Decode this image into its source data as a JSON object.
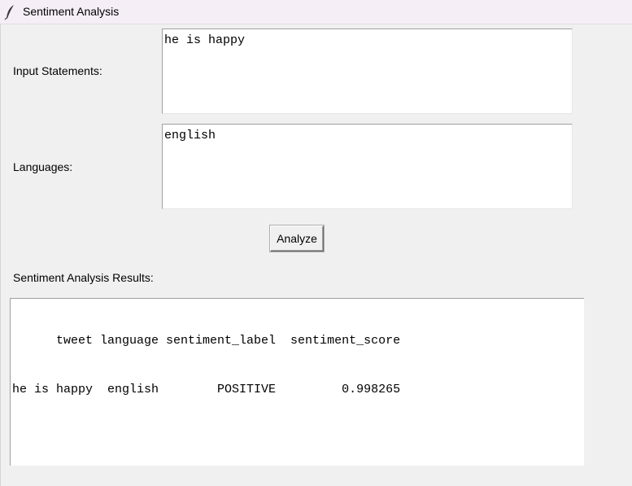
{
  "window": {
    "title": "Sentiment Analysis",
    "icon": "feather-icon"
  },
  "form": {
    "statements_label": "Input Statements:",
    "statements_value": "he is happy",
    "languages_label": "Languages:",
    "languages_value": "english",
    "analyze_label": "Analyze"
  },
  "results": {
    "label": "Sentiment Analysis Results:",
    "header": "      tweet language sentiment_label  sentiment_score",
    "rows": [
      "he is happy  english        POSITIVE         0.998265"
    ]
  }
}
